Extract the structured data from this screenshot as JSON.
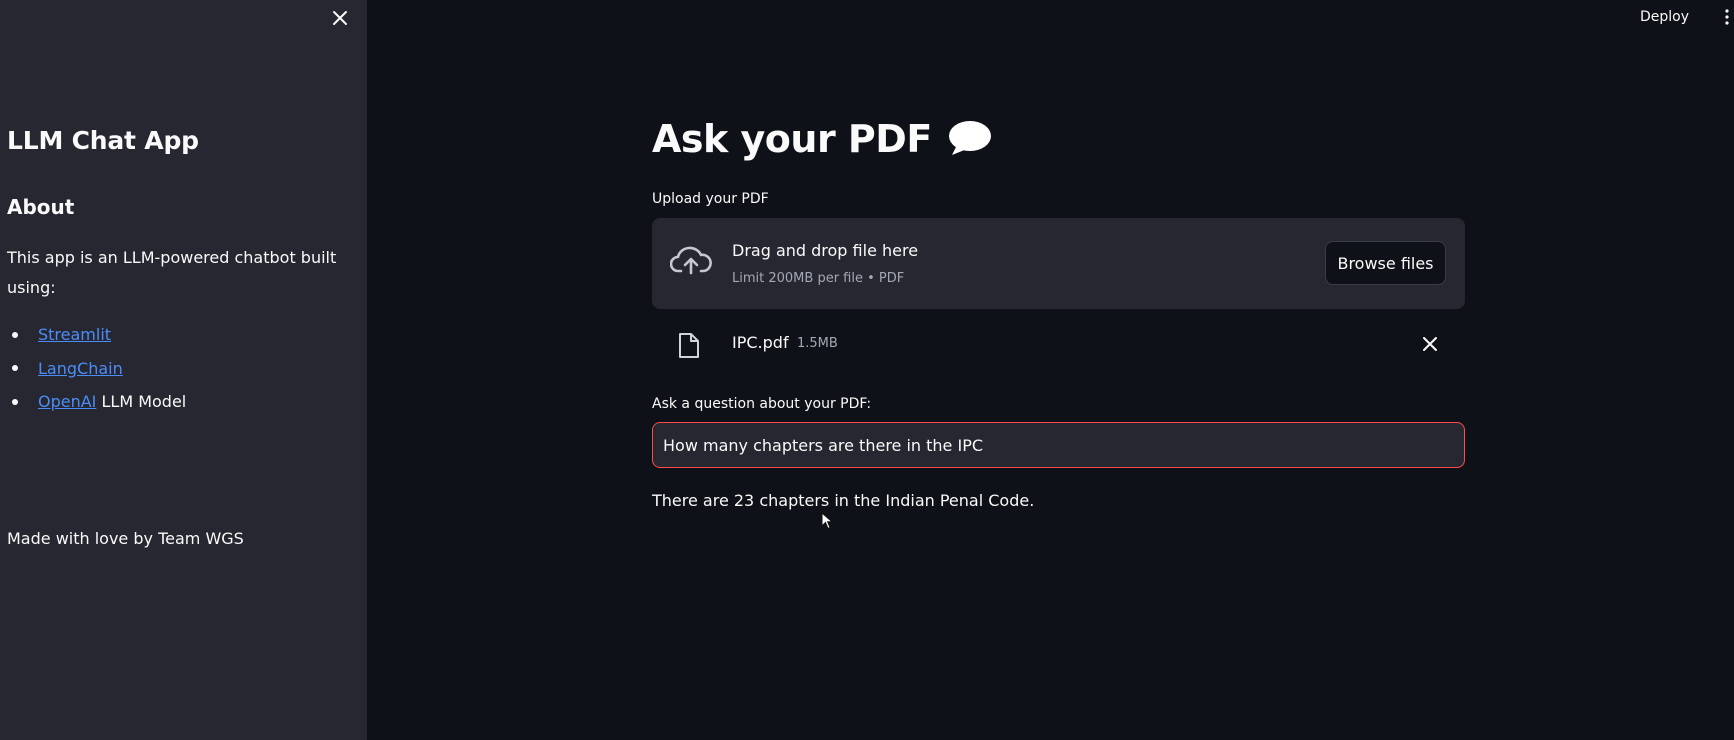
{
  "sidebar": {
    "close_icon": "close-icon",
    "title": "LLM Chat App",
    "about_heading": "About",
    "about_text": "This app is an LLM-powered chatbot built using:",
    "list": [
      {
        "link": "Streamlit",
        "suffix": ""
      },
      {
        "link": "LangChain",
        "suffix": ""
      },
      {
        "link": "OpenAI",
        "suffix": " LLM Model"
      }
    ],
    "footer": "Made with love by Team WGS"
  },
  "header": {
    "deploy_label": "Deploy",
    "menu_icon": "vertical-dots-icon"
  },
  "main": {
    "title": "Ask your PDF",
    "title_icon": "speech-bubble-icon",
    "upload": {
      "label": "Upload your PDF",
      "drag_text": "Drag and drop file here",
      "limit_text": "Limit 200MB per file • PDF",
      "browse_label": "Browse files",
      "icon": "cloud-upload-icon"
    },
    "file": {
      "name": "IPC.pdf",
      "size": "1.5MB",
      "icon": "file-icon"
    },
    "question": {
      "label": "Ask a question about your PDF:",
      "value": "How many chapters are there in the IPC"
    },
    "answer": "There are 23 chapters in the Indian Penal Code."
  },
  "colors": {
    "background": "#0e1117",
    "sidebar": "#262730",
    "link": "#4b8df8",
    "focus_border": "#ff4b4b"
  }
}
